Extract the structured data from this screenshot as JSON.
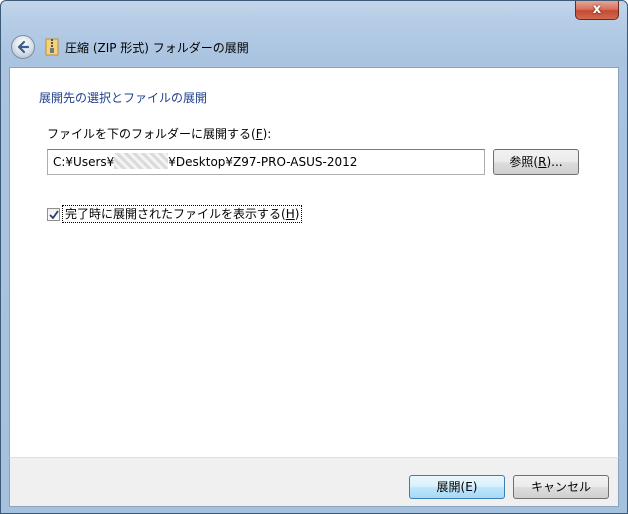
{
  "window": {
    "title": "圧縮 (ZIP 形式) フォルダーの展開",
    "close_label": "x"
  },
  "content": {
    "heading": "展開先の選択とファイルの展開",
    "field_label_text": "ファイルを下のフォルダーに展開する(",
    "field_label_key": "F",
    "field_label_end": "):",
    "path_prefix": "C:¥Users¥",
    "path_suffix": "¥Desktop¥Z97-PRO-ASUS-2012",
    "browse_text": "参照(",
    "browse_key": "R",
    "browse_end": ")...",
    "checkbox_checked": true,
    "checkbox_text": "完了時に展開されたファイルを表示する(",
    "checkbox_key": "H",
    "checkbox_end": ")"
  },
  "footer": {
    "extract_label": "展開(E)",
    "cancel_label": "キャンセル"
  },
  "colors": {
    "heading": "#1e3f8f",
    "close_button": "#c44a33",
    "frame": "#a9c3e0"
  }
}
